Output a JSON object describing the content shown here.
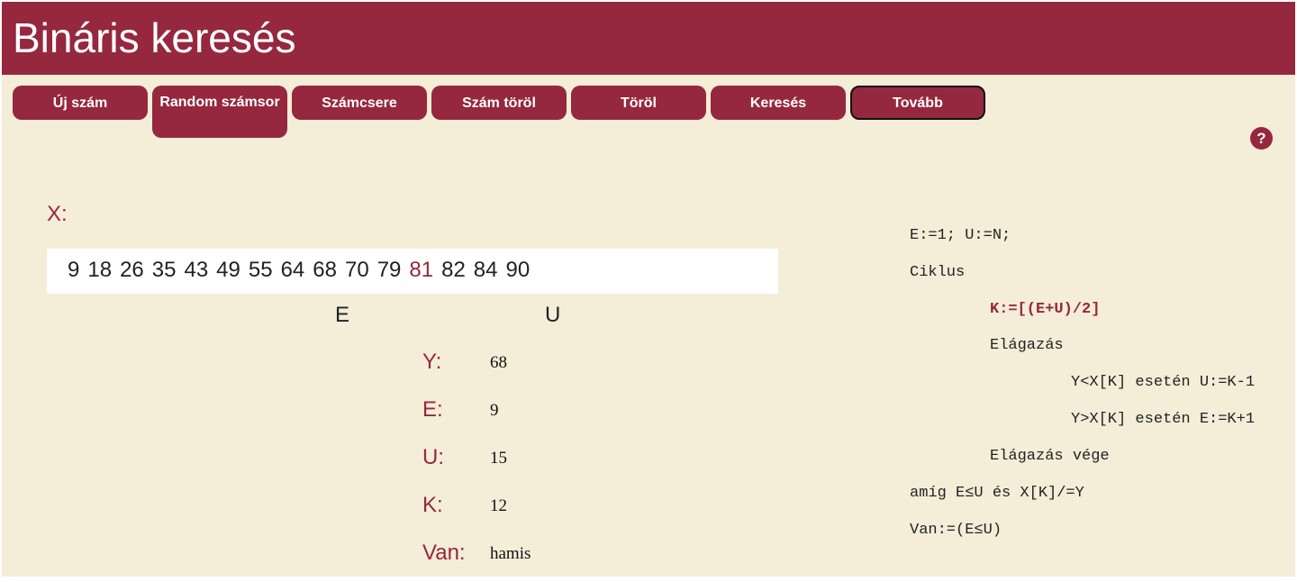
{
  "header": {
    "title": "Bináris keresés"
  },
  "toolbar": {
    "buttons": [
      {
        "label": "Új szám"
      },
      {
        "label": "Random számsor"
      },
      {
        "label": "Számcsere"
      },
      {
        "label": "Szám töröl"
      },
      {
        "label": "Töröl"
      },
      {
        "label": "Keresés"
      },
      {
        "label": "Tovább"
      }
    ],
    "help_label": "?"
  },
  "array": {
    "label": "X:",
    "values": [
      "9",
      "18",
      "26",
      "35",
      "43",
      "49",
      "55",
      "64",
      "68",
      "70",
      "79",
      "81",
      "82",
      "84",
      "90"
    ],
    "highlighted_value": "81",
    "markers": {
      "e": "E",
      "u": "U"
    }
  },
  "variables": {
    "y": {
      "label": "Y:",
      "value": "68"
    },
    "e": {
      "label": "E:",
      "value": "9"
    },
    "u": {
      "label": "U:",
      "value": "15"
    },
    "k": {
      "label": "K:",
      "value": "12"
    },
    "van": {
      "label": "Van:",
      "value": "hamis"
    }
  },
  "algorithm": {
    "lines": [
      "E:=1; U:=N;",
      "Ciklus",
      "K:=[(E+U)/2]",
      "Elágazás",
      "Y<X[K] esetén U:=K-1",
      "Y>X[K] esetén E:=K+1",
      "Elágazás vége",
      "amíg E≤U és X[K]/=Y",
      "Van:=(E≤U)"
    ],
    "active_line": "K:=[(E+U)/2]"
  },
  "colors": {
    "accent": "#95283e",
    "background": "#f4edd7",
    "array_background": "#ffffff"
  }
}
